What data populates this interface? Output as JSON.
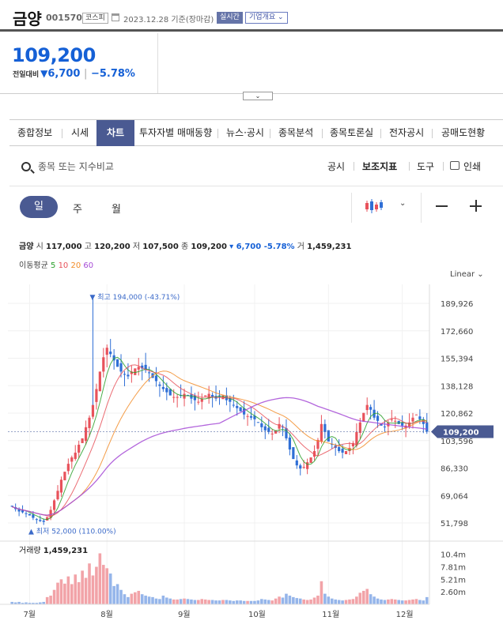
{
  "header": {
    "name": "금양",
    "code": "001570",
    "market": "코스피",
    "date": "2023.12.28 기준(장마감)",
    "realtime": "실시간",
    "company_info": "기업개요 ⌄"
  },
  "quote": {
    "price": "109,200",
    "prev_label": "전일대비",
    "change": "6,700",
    "change_pct": "−5.78%",
    "down_arrow": "▼"
  },
  "toggle_label": "⌄",
  "tabs": [
    "종합정보",
    "시세",
    "차트",
    "투자자별 매매동향",
    "뉴스·공시",
    "종목분석",
    "종목토론실",
    "전자공시",
    "공매도현황"
  ],
  "toolbar": {
    "search_placeholder": "종목 또는 지수비교",
    "disclosure": "공시",
    "indicator": "보조지표",
    "tools": "도구",
    "print": "인쇄"
  },
  "period": {
    "day": "일",
    "week": "주",
    "month": "월",
    "chevron": "⌄"
  },
  "ohlc": {
    "name": "금양",
    "open_label": "시",
    "open": "117,000",
    "high_label": "고",
    "high": "120,200",
    "low_label": "저",
    "low": "107,500",
    "close_label": "종",
    "close": "109,200",
    "change": "▾ 6,700 -5.78%",
    "volume_label": "거",
    "volume": "1,459,231"
  },
  "ma": {
    "label": "이동평균",
    "periods": [
      "5",
      "10",
      "20",
      "60"
    ],
    "colors": [
      "#2ca02c",
      "#e8525b",
      "#f28c28",
      "#a64bd6"
    ]
  },
  "scale_label": "Linear ⌄",
  "chart_data": {
    "type": "candlestick",
    "y_ticks": [
      "189,926",
      "172,660",
      "155,394",
      "138,128",
      "120,862",
      "103,596",
      "86,330",
      "69,064",
      "51,798"
    ],
    "y_tick_values": [
      189926,
      172660,
      155394,
      138128,
      120862,
      103596,
      86330,
      69064,
      51798
    ],
    "x_ticks": [
      "7월",
      "8월",
      "9월",
      "10월",
      "11월",
      "12월"
    ],
    "last_price_label": "109,200",
    "last_price": 109200,
    "high_annotation": "▼ 최고 194,000 (-43.71%)",
    "high_value": 194000,
    "low_annotation": "▲ 최저 52,000 (110.00%)",
    "low_value": 52000,
    "up_color": "#e8525b",
    "down_color": "#2f6fd6",
    "volume_label": "거래량",
    "volume_value": "1,459,231",
    "volume_ticks": [
      "10.4m",
      "7.81m",
      "5.21m",
      "2.60m"
    ],
    "volume_tick_values": [
      10.4,
      7.81,
      5.21,
      2.6
    ],
    "closes": [
      62000,
      60500,
      59000,
      58500,
      57500,
      56500,
      55000,
      54000,
      53000,
      52500,
      55500,
      60000,
      66000,
      72000,
      79000,
      84000,
      89000,
      93000,
      96000,
      101000,
      105000,
      112000,
      118000,
      126000,
      136000,
      147000,
      156000,
      162000,
      158000,
      154000,
      150000,
      147000,
      145000,
      144000,
      147000,
      149000,
      150000,
      149000,
      148000,
      146000,
      143000,
      141000,
      138000,
      136000,
      134000,
      132000,
      131000,
      131000,
      132000,
      133000,
      132000,
      130000,
      129000,
      128000,
      130000,
      132000,
      133000,
      131000,
      130000,
      131000,
      132000,
      129000,
      128000,
      126000,
      124000,
      122000,
      120000,
      119000,
      118000,
      117000,
      115000,
      112000,
      110000,
      109000,
      108000,
      110000,
      114000,
      112000,
      105000,
      98000,
      92000,
      88000,
      86000,
      87000,
      90000,
      93000,
      97000,
      104000,
      114000,
      109000,
      103000,
      101000,
      99000,
      97000,
      96000,
      97000,
      99000,
      102000,
      109000,
      115000,
      121000,
      126000,
      123000,
      118000,
      116000,
      113000,
      112000,
      115000,
      117000,
      116000,
      114000,
      113000,
      113000,
      115000,
      118000,
      120000,
      117000,
      114000,
      109200
    ],
    "volumes": [
      0.5,
      0.4,
      0.5,
      0.3,
      0.4,
      0.3,
      0.3,
      0.3,
      0.4,
      0.5,
      1.5,
      1.8,
      3.0,
      4.5,
      5.2,
      4.3,
      5.8,
      4.2,
      6.2,
      4.6,
      7.0,
      5.5,
      8.5,
      6.0,
      7.8,
      10.6,
      8.2,
      7.5,
      6.4,
      3.8,
      4.2,
      3.0,
      2.1,
      1.5,
      2.2,
      2.5,
      2.8,
      2.1,
      1.8,
      1.6,
      1.5,
      1.2,
      1.1,
      1.8,
      1.4,
      1.2,
      1.0,
      1.0,
      1.1,
      1.2,
      1.1,
      1.0,
      0.9,
      0.9,
      1.1,
      1.0,
      0.9,
      0.9,
      0.8,
      0.8,
      0.9,
      0.9,
      0.8,
      0.7,
      0.8,
      0.8,
      0.7,
      0.7,
      0.7,
      0.7,
      0.8,
      1.1,
      1.0,
      0.9,
      0.8,
      1.2,
      1.6,
      1.4,
      2.2,
      1.8,
      1.5,
      1.3,
      1.2,
      1.0,
      0.9,
      1.0,
      1.4,
      1.8,
      4.8,
      2.2,
      1.6,
      1.2,
      1.0,
      0.9,
      0.8,
      0.9,
      1.0,
      1.1,
      1.6,
      2.4,
      2.8,
      3.2,
      2.1,
      1.6,
      1.2,
      1.0,
      0.9,
      1.0,
      1.1,
      1.0,
      0.9,
      0.8,
      0.8,
      0.9,
      1.0,
      1.1,
      0.9,
      0.8,
      1.5
    ],
    "month_tick_index": [
      5,
      27,
      49,
      69,
      90,
      111
    ]
  }
}
